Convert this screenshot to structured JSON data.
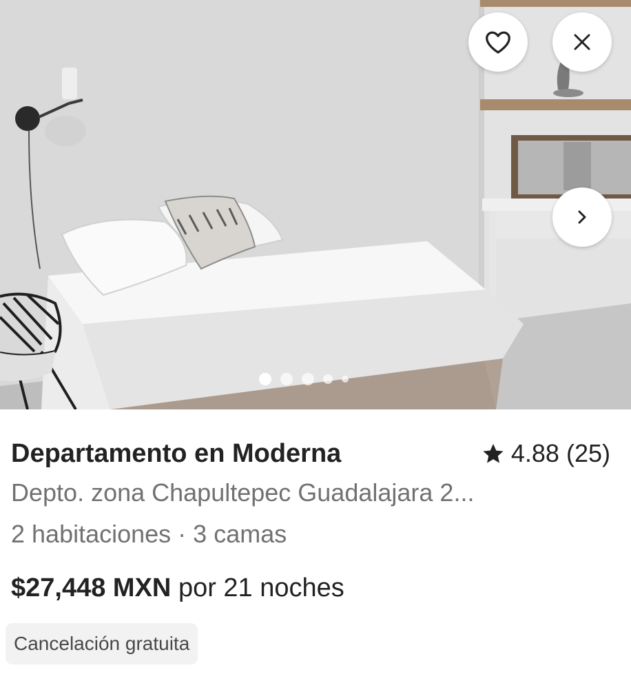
{
  "listing": {
    "photo_alt": "Bedroom with white bed",
    "title": "Departamento en Moderna",
    "rating": "4.88",
    "review_count": "(25)",
    "subtitle": "Depto. zona Chapultepec Guadalajara 2...",
    "details": "2 habitaciones · 3 camas",
    "price": "$27,448 MXN",
    "price_suffix": "por 21 noches",
    "badge": "Cancelación gratuita"
  },
  "icons": {
    "favorite": "heart-icon",
    "close": "close-icon",
    "next": "chevron-right-icon",
    "rating": "star-icon"
  },
  "carousel": {
    "total_images": 5,
    "active_index": 0
  },
  "colors": {
    "text_primary": "#222222",
    "text_secondary": "#717171",
    "badge_bg": "#f2f2f2"
  }
}
